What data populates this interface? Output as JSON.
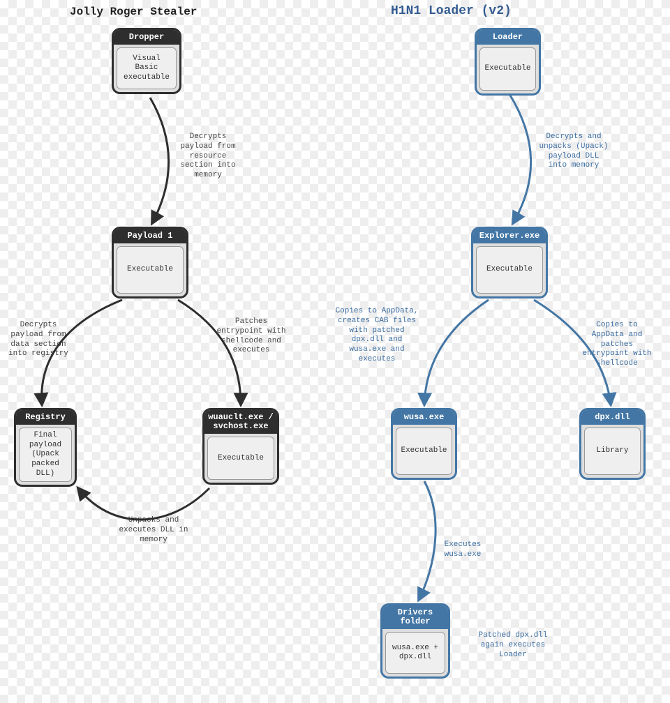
{
  "diagram": {
    "left": {
      "title": "Jolly Roger Stealer",
      "nodes": {
        "dropper": {
          "header": "Dropper",
          "body": "Visual Basic executable"
        },
        "payload1": {
          "header": "Payload 1",
          "body": "Executable"
        },
        "registry": {
          "header": "Registry",
          "body": "Final payload (Upack packed DLL)"
        },
        "wuauclt": {
          "header": "wuauclt.exe / svchost.exe",
          "body": "Executable"
        }
      },
      "edges": {
        "dropper_to_payload1": "Decrypts payload from resource section into memory",
        "payload1_to_registry": "Decrypts payload from data section into registry",
        "payload1_to_wuauclt": "Patches entrypoint with shellcode and executes",
        "wuauclt_to_registry": "Unpacks and executes DLL in memory"
      }
    },
    "right": {
      "title": "H1N1 Loader (v2)",
      "nodes": {
        "loader": {
          "header": "Loader",
          "body": "Executable"
        },
        "explorer": {
          "header": "Explorer.exe",
          "body": "Executable"
        },
        "wusa": {
          "header": "wusa.exe",
          "body": "Executable"
        },
        "dpx": {
          "header": "dpx.dll",
          "body": "Library"
        },
        "drivers": {
          "header": "Drivers folder",
          "body": "wusa.exe + dpx.dll"
        }
      },
      "edges": {
        "loader_to_explorer": "Decrypts and unpacks (Upack) payload DLL into memory",
        "explorer_to_wusa": "Copies to AppData, creates CAB files with patched dpx.dll and wusa.exe and executes",
        "explorer_to_dpx": "Copies to AppData and patches entrypoint with shellcode",
        "wusa_to_drivers": "Executes wusa.exe",
        "drivers_note": "Patched dpx.dll again executes Loader"
      }
    }
  }
}
